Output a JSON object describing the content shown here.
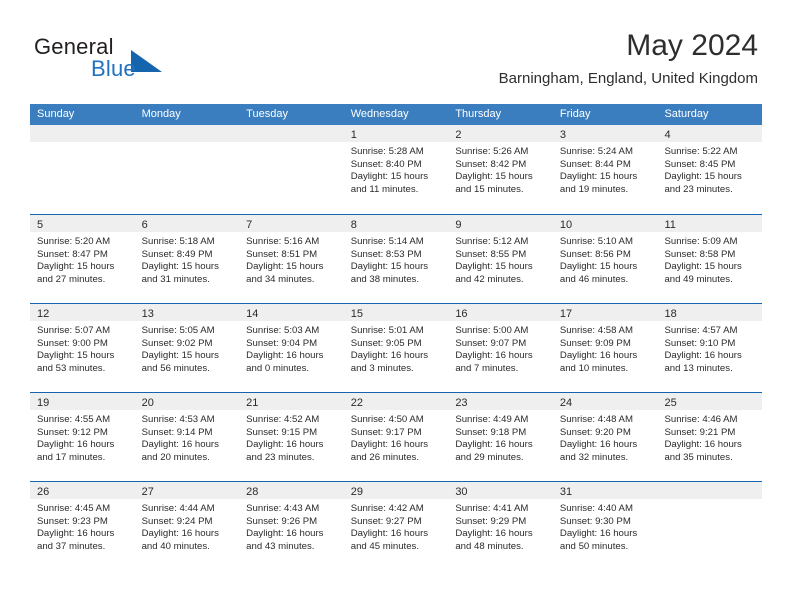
{
  "brand": {
    "name_part1": "General",
    "name_part2": "Blue",
    "triangle_color": "#1565ae",
    "blue_color": "#1f72c0"
  },
  "header": {
    "month_title": "May 2024",
    "location": "Barningham, England, United Kingdom"
  },
  "theme": {
    "weekday_header_bg": "#3a7ebf",
    "weekday_header_text": "#ffffff",
    "day_band_bg": "#efefef",
    "row_border": "#1565ae",
    "body_text": "#2b2b2b"
  },
  "weekdays": [
    "Sunday",
    "Monday",
    "Tuesday",
    "Wednesday",
    "Thursday",
    "Friday",
    "Saturday"
  ],
  "weeks": [
    [
      {
        "day": "",
        "lines": []
      },
      {
        "day": "",
        "lines": []
      },
      {
        "day": "",
        "lines": []
      },
      {
        "day": "1",
        "lines": [
          "Sunrise: 5:28 AM",
          "Sunset: 8:40 PM",
          "Daylight: 15 hours",
          "and 11 minutes."
        ]
      },
      {
        "day": "2",
        "lines": [
          "Sunrise: 5:26 AM",
          "Sunset: 8:42 PM",
          "Daylight: 15 hours",
          "and 15 minutes."
        ]
      },
      {
        "day": "3",
        "lines": [
          "Sunrise: 5:24 AM",
          "Sunset: 8:44 PM",
          "Daylight: 15 hours",
          "and 19 minutes."
        ]
      },
      {
        "day": "4",
        "lines": [
          "Sunrise: 5:22 AM",
          "Sunset: 8:45 PM",
          "Daylight: 15 hours",
          "and 23 minutes."
        ]
      }
    ],
    [
      {
        "day": "5",
        "lines": [
          "Sunrise: 5:20 AM",
          "Sunset: 8:47 PM",
          "Daylight: 15 hours",
          "and 27 minutes."
        ]
      },
      {
        "day": "6",
        "lines": [
          "Sunrise: 5:18 AM",
          "Sunset: 8:49 PM",
          "Daylight: 15 hours",
          "and 31 minutes."
        ]
      },
      {
        "day": "7",
        "lines": [
          "Sunrise: 5:16 AM",
          "Sunset: 8:51 PM",
          "Daylight: 15 hours",
          "and 34 minutes."
        ]
      },
      {
        "day": "8",
        "lines": [
          "Sunrise: 5:14 AM",
          "Sunset: 8:53 PM",
          "Daylight: 15 hours",
          "and 38 minutes."
        ]
      },
      {
        "day": "9",
        "lines": [
          "Sunrise: 5:12 AM",
          "Sunset: 8:55 PM",
          "Daylight: 15 hours",
          "and 42 minutes."
        ]
      },
      {
        "day": "10",
        "lines": [
          "Sunrise: 5:10 AM",
          "Sunset: 8:56 PM",
          "Daylight: 15 hours",
          "and 46 minutes."
        ]
      },
      {
        "day": "11",
        "lines": [
          "Sunrise: 5:09 AM",
          "Sunset: 8:58 PM",
          "Daylight: 15 hours",
          "and 49 minutes."
        ]
      }
    ],
    [
      {
        "day": "12",
        "lines": [
          "Sunrise: 5:07 AM",
          "Sunset: 9:00 PM",
          "Daylight: 15 hours",
          "and 53 minutes."
        ]
      },
      {
        "day": "13",
        "lines": [
          "Sunrise: 5:05 AM",
          "Sunset: 9:02 PM",
          "Daylight: 15 hours",
          "and 56 minutes."
        ]
      },
      {
        "day": "14",
        "lines": [
          "Sunrise: 5:03 AM",
          "Sunset: 9:04 PM",
          "Daylight: 16 hours",
          "and 0 minutes."
        ]
      },
      {
        "day": "15",
        "lines": [
          "Sunrise: 5:01 AM",
          "Sunset: 9:05 PM",
          "Daylight: 16 hours",
          "and 3 minutes."
        ]
      },
      {
        "day": "16",
        "lines": [
          "Sunrise: 5:00 AM",
          "Sunset: 9:07 PM",
          "Daylight: 16 hours",
          "and 7 minutes."
        ]
      },
      {
        "day": "17",
        "lines": [
          "Sunrise: 4:58 AM",
          "Sunset: 9:09 PM",
          "Daylight: 16 hours",
          "and 10 minutes."
        ]
      },
      {
        "day": "18",
        "lines": [
          "Sunrise: 4:57 AM",
          "Sunset: 9:10 PM",
          "Daylight: 16 hours",
          "and 13 minutes."
        ]
      }
    ],
    [
      {
        "day": "19",
        "lines": [
          "Sunrise: 4:55 AM",
          "Sunset: 9:12 PM",
          "Daylight: 16 hours",
          "and 17 minutes."
        ]
      },
      {
        "day": "20",
        "lines": [
          "Sunrise: 4:53 AM",
          "Sunset: 9:14 PM",
          "Daylight: 16 hours",
          "and 20 minutes."
        ]
      },
      {
        "day": "21",
        "lines": [
          "Sunrise: 4:52 AM",
          "Sunset: 9:15 PM",
          "Daylight: 16 hours",
          "and 23 minutes."
        ]
      },
      {
        "day": "22",
        "lines": [
          "Sunrise: 4:50 AM",
          "Sunset: 9:17 PM",
          "Daylight: 16 hours",
          "and 26 minutes."
        ]
      },
      {
        "day": "23",
        "lines": [
          "Sunrise: 4:49 AM",
          "Sunset: 9:18 PM",
          "Daylight: 16 hours",
          "and 29 minutes."
        ]
      },
      {
        "day": "24",
        "lines": [
          "Sunrise: 4:48 AM",
          "Sunset: 9:20 PM",
          "Daylight: 16 hours",
          "and 32 minutes."
        ]
      },
      {
        "day": "25",
        "lines": [
          "Sunrise: 4:46 AM",
          "Sunset: 9:21 PM",
          "Daylight: 16 hours",
          "and 35 minutes."
        ]
      }
    ],
    [
      {
        "day": "26",
        "lines": [
          "Sunrise: 4:45 AM",
          "Sunset: 9:23 PM",
          "Daylight: 16 hours",
          "and 37 minutes."
        ]
      },
      {
        "day": "27",
        "lines": [
          "Sunrise: 4:44 AM",
          "Sunset: 9:24 PM",
          "Daylight: 16 hours",
          "and 40 minutes."
        ]
      },
      {
        "day": "28",
        "lines": [
          "Sunrise: 4:43 AM",
          "Sunset: 9:26 PM",
          "Daylight: 16 hours",
          "and 43 minutes."
        ]
      },
      {
        "day": "29",
        "lines": [
          "Sunrise: 4:42 AM",
          "Sunset: 9:27 PM",
          "Daylight: 16 hours",
          "and 45 minutes."
        ]
      },
      {
        "day": "30",
        "lines": [
          "Sunrise: 4:41 AM",
          "Sunset: 9:29 PM",
          "Daylight: 16 hours",
          "and 48 minutes."
        ]
      },
      {
        "day": "31",
        "lines": [
          "Sunrise: 4:40 AM",
          "Sunset: 9:30 PM",
          "Daylight: 16 hours",
          "and 50 minutes."
        ]
      },
      {
        "day": "",
        "lines": []
      }
    ]
  ]
}
